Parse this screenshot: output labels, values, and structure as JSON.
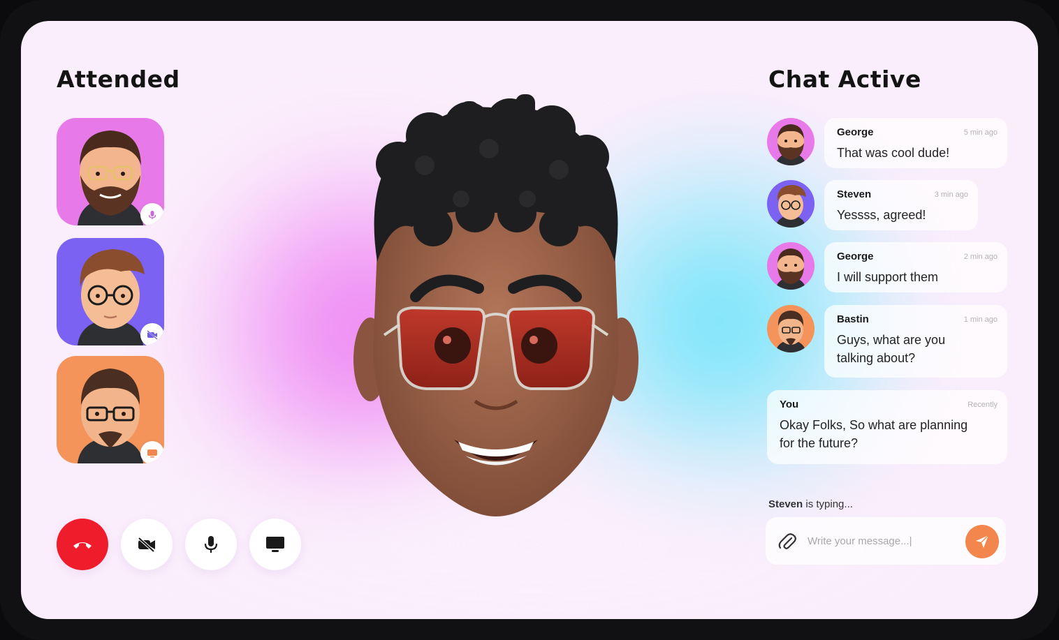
{
  "attended": {
    "title": "Attended",
    "participants": [
      {
        "avatar_color": "#e879e8",
        "badge_icon": "microphone-icon"
      },
      {
        "avatar_color": "#7b62f3",
        "badge_icon": "video-off-icon"
      },
      {
        "avatar_color": "#f4935a",
        "badge_icon": "screen-share-icon"
      }
    ]
  },
  "controls": [
    {
      "icon": "end-call-icon",
      "color": "#ef1c2c"
    },
    {
      "icon": "video-off-icon"
    },
    {
      "icon": "microphone-icon"
    },
    {
      "icon": "screen-share-icon"
    }
  ],
  "chat": {
    "title": "Chat Active",
    "messages": [
      {
        "name": "George",
        "time": "5 min ago",
        "text": "That was cool dude!",
        "avatar_color": "#e879e8"
      },
      {
        "name": "Steven",
        "time": "3 min ago",
        "text": "Yessss, agreed!",
        "avatar_color": "#7b62f3"
      },
      {
        "name": "George",
        "time": "2 min ago",
        "text": "I will support them",
        "avatar_color": "#e879e8"
      },
      {
        "name": "Bastin",
        "time": "1 min ago",
        "text_line1": "Guys, what are you",
        "text_line2": "talking about?",
        "avatar_color": "#f4935a"
      },
      {
        "name": "You",
        "time": "Recently",
        "text_line1": "Okay Folks, So what are planning",
        "text_line2": "for the future?"
      }
    ],
    "typing_name": "Steven",
    "typing_suffix": " is typing...",
    "composer_placeholder": "Write your message...|",
    "send_color": "#f3864d"
  }
}
